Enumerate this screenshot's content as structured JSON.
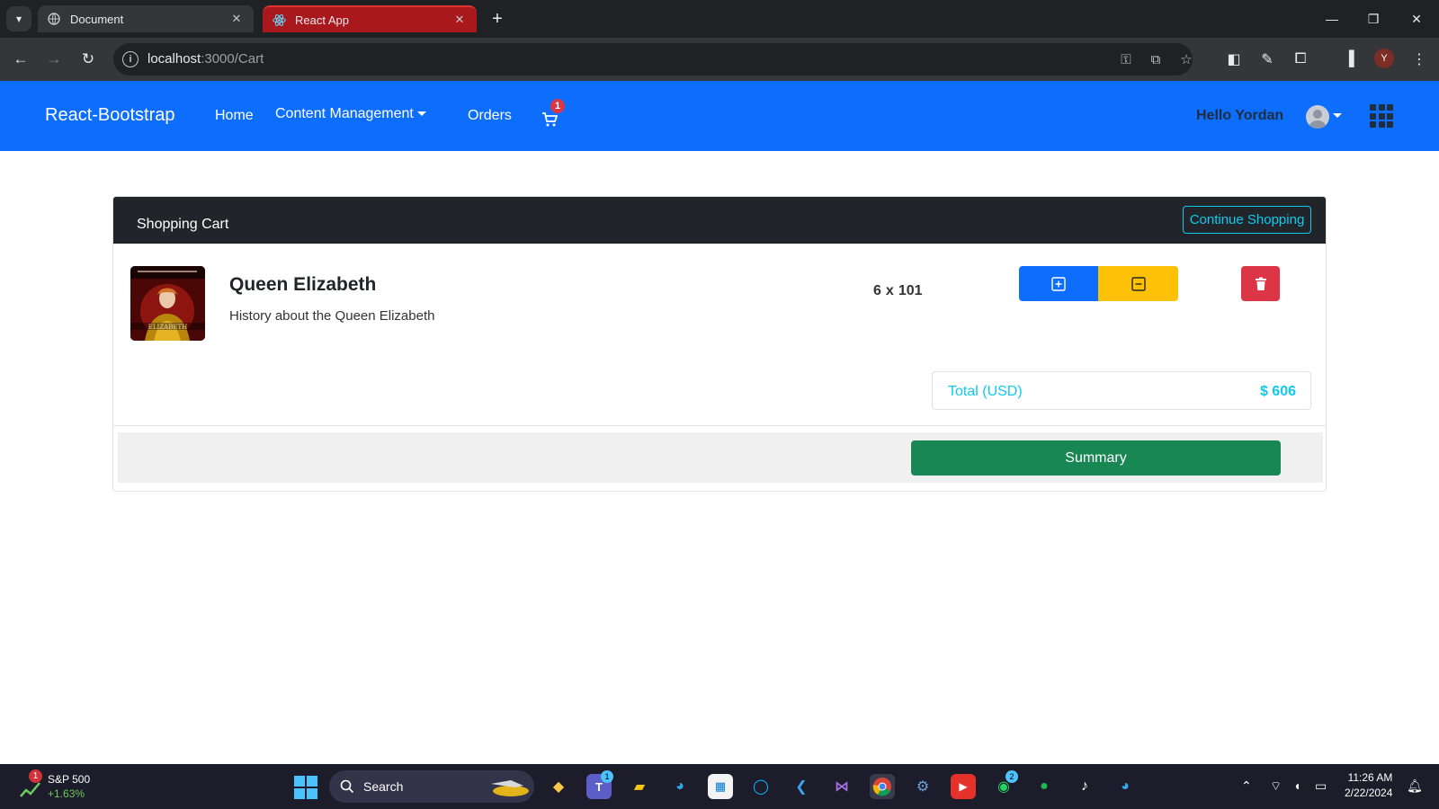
{
  "browser": {
    "tabs": [
      {
        "title": "Document",
        "active": false
      },
      {
        "title": "React App",
        "active": true
      }
    ],
    "url_host": "localhost",
    "url_path": ":3000/Cart",
    "profile_initial": "Y"
  },
  "navbar": {
    "brand": "React-Bootstrap",
    "links": [
      "Home",
      "Content Management",
      "Orders"
    ],
    "cart_count": "1",
    "greeting": "Hello Yordan",
    "bg_color": "#0d6efd"
  },
  "cart": {
    "title": "Shopping Cart",
    "continue_label": "Continue Shopping",
    "items": [
      {
        "name": "Queen Elizabeth",
        "description": "History about the Queen Elizabeth",
        "quantity": "6",
        "times": "x",
        "price": "101",
        "image_caption": "ELIZABETH"
      }
    ],
    "total_label": "Total (USD)",
    "total_value": "$ 606",
    "summary_label": "Summary"
  },
  "taskbar": {
    "stock_badge": "1",
    "stock_name": "S&P 500",
    "stock_change": "+1.63%",
    "search_label": "Search",
    "time": "11:26 AM",
    "date": "2/22/2024",
    "teams_badge": "1",
    "whatsapp_badge": "2"
  },
  "colors": {
    "primary": "#0d6efd",
    "warning": "#ffc107",
    "danger": "#dc3545",
    "success": "#198754",
    "info": "#0dcaf0",
    "dark": "#212529"
  }
}
